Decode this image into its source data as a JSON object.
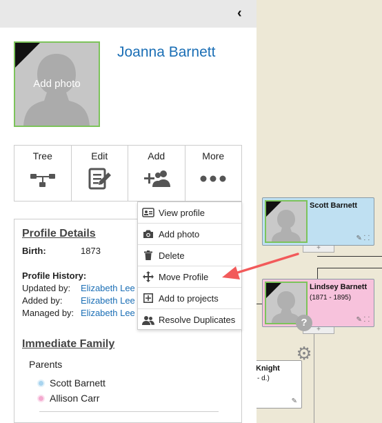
{
  "panel": {
    "collapse_glyph": "‹",
    "profile_name": "Joanna Barnett",
    "photo_label": "Add photo"
  },
  "actions": [
    {
      "label": "Tree",
      "icon": "tree-icon"
    },
    {
      "label": "Edit",
      "icon": "edit-icon"
    },
    {
      "label": "Add",
      "icon": "add-person-icon"
    },
    {
      "label": "More",
      "icon": "more-icon"
    }
  ],
  "details": {
    "title": "Profile Details",
    "birth_label": "Birth:",
    "birth_value": "1873",
    "history_title": "Profile History:",
    "updated_label": "Updated by:",
    "updated_value": "Elizabeth Lee",
    "added_label": "Added by:",
    "added_value": "Elizabeth Lee",
    "managed_label": "Managed by:",
    "managed_value": "Elizabeth Lee"
  },
  "family": {
    "title": "Immediate Family",
    "parents_label": "Parents",
    "parents": [
      {
        "name": "Scott Barnett",
        "color": "#a8d4ef"
      },
      {
        "name": "Allison Carr",
        "color": "#f4a9cf"
      }
    ]
  },
  "menu": {
    "items": [
      {
        "label": "View profile",
        "icon": "id-card-icon"
      },
      {
        "label": "Add photo",
        "icon": "camera-icon"
      },
      {
        "label": "Delete",
        "icon": "trash-icon"
      },
      {
        "label": "Move Profile",
        "icon": "move-icon"
      },
      {
        "label": "Add to projects",
        "icon": "plus-square-icon"
      },
      {
        "label": "Resolve Duplicates",
        "icon": "people-icon"
      }
    ]
  },
  "tree": {
    "nodes": [
      {
        "name": "Scott Barnett",
        "dates": "",
        "color": "#bfe0f2"
      },
      {
        "name": "Lindsey Barnett",
        "dates": "(1871 - 1895)",
        "color": "#f7c2dc"
      },
      {
        "name": "Knight",
        "dates": "- d.)",
        "color": "#ffffff"
      }
    ]
  },
  "colors": {
    "accent_link": "#1a6eb5",
    "photo_border": "#7cc35a",
    "annotation_arrow": "#f25a5a"
  }
}
